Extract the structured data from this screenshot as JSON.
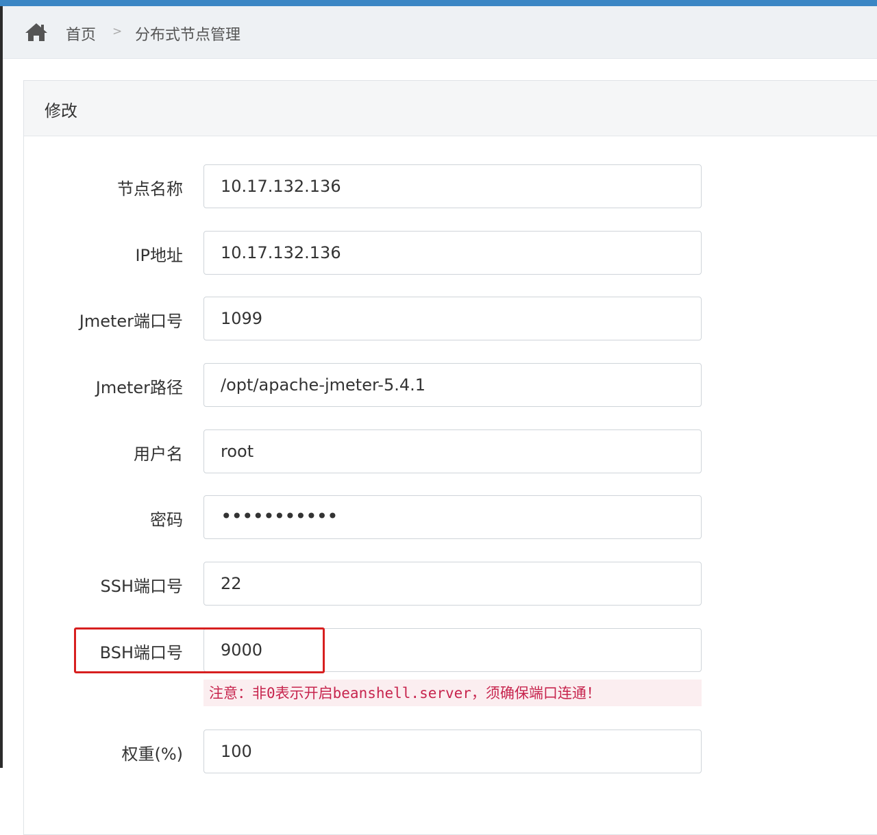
{
  "breadcrumb": {
    "home_icon": "home-icon",
    "home_label": "首页",
    "separator": ">",
    "current": "分布式节点管理"
  },
  "panel": {
    "title": "修改"
  },
  "form": {
    "node_name": {
      "label": "节点名称",
      "value": "10.17.132.136"
    },
    "ip": {
      "label": "IP地址",
      "value": "10.17.132.136"
    },
    "jmeter_port": {
      "label": "Jmeter端口号",
      "value": "1099"
    },
    "jmeter_path": {
      "label": "Jmeter路径",
      "value": "/opt/apache-jmeter-5.4.1"
    },
    "username": {
      "label": "用户名",
      "value": "root"
    },
    "password": {
      "label": "密码",
      "value": "•••••••••••"
    },
    "ssh_port": {
      "label": "SSH端口号",
      "value": "22"
    },
    "bsh_port": {
      "label": "BSH端口号",
      "value": "9000",
      "note": "注意：非0表示开启beanshell.server，须确保端口连通！"
    },
    "weight": {
      "label": "权重(%)",
      "value": "100"
    }
  },
  "colors": {
    "accent_top": "#3b86c4",
    "highlight": "#d71f1f",
    "note_text": "#c7254e",
    "note_bg": "#fbeef0"
  }
}
